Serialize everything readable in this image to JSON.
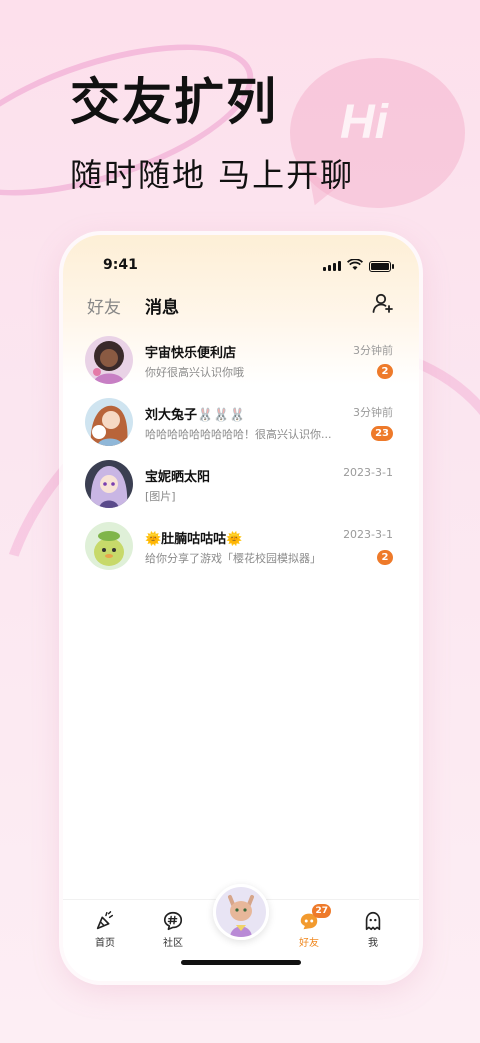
{
  "promo": {
    "headline": "交友扩列",
    "subline": "随时随地 马上开聊",
    "bubble_text": "Hi"
  },
  "status_bar": {
    "time": "9:41"
  },
  "header": {
    "tab_friends": "好友",
    "tab_messages": "消息",
    "add_friend_icon": "add-person-icon"
  },
  "chats": [
    {
      "name": "宇宙快乐便利店",
      "preview": "你好很高兴认识你哦",
      "time": "3分钟前",
      "unread": "2"
    },
    {
      "name": "刘大兔子🐰🐰🐰",
      "preview": "哈哈哈哈哈哈哈哈哈！很高兴认识你...",
      "time": "3分钟前",
      "unread": "23"
    },
    {
      "name": "宝妮晒太阳",
      "preview": "[图片]",
      "time": "2023-3-1",
      "unread": ""
    },
    {
      "name": "🌞肚腩咕咕咕🌞",
      "preview": "给你分享了游戏「樱花校园模拟器」",
      "time": "2023-3-1",
      "unread": "2"
    }
  ],
  "tabbar": {
    "home": "首页",
    "community": "社区",
    "friends": "好友",
    "friends_badge": "27",
    "me": "我"
  },
  "colors": {
    "accent": "#ee7a2a",
    "active_tab": "#f08a23",
    "background": "#fde0ec"
  }
}
